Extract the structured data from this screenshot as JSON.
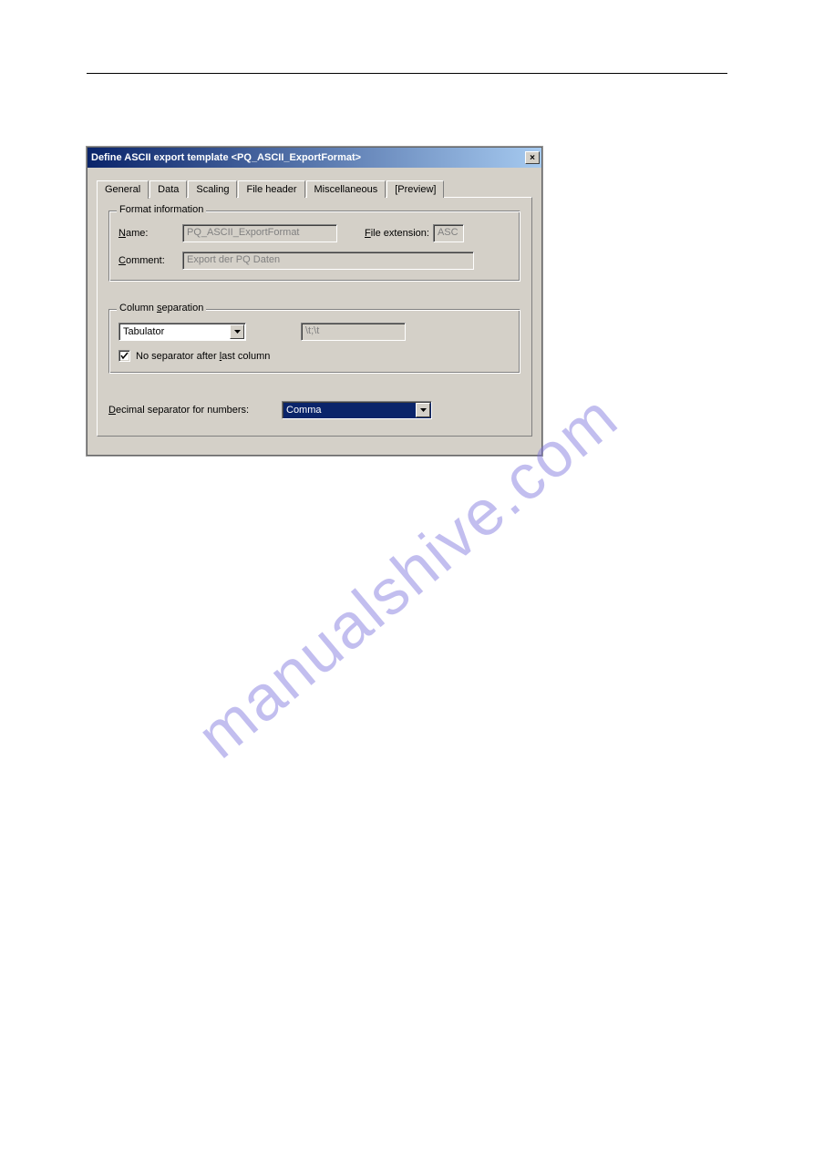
{
  "watermark": "manualshive.com",
  "dialog": {
    "title": "Define ASCII export template <PQ_ASCII_ExportFormat>",
    "close": "×",
    "tabs": [
      {
        "label": "General",
        "active": true
      },
      {
        "label": "Data",
        "active": false
      },
      {
        "label": "Scaling",
        "active": false
      },
      {
        "label": "File header",
        "active": false
      },
      {
        "label": "Miscellaneous",
        "active": false
      },
      {
        "label": "[Preview]",
        "active": false
      }
    ],
    "format_info": {
      "legend": "Format information",
      "name_label_pre": "N",
      "name_label_post": "ame:",
      "name_value": "PQ_ASCII_ExportFormat",
      "ext_label_pre": "F",
      "ext_label_post": "ile extension:",
      "ext_value": "ASC",
      "comment_label_pre": "C",
      "comment_label_post": "omment:",
      "comment_value": "Export der PQ Daten"
    },
    "col_sep": {
      "legend_pre": "Column ",
      "legend_u": "s",
      "legend_post": "eparation",
      "combo_value": "Tabulator",
      "sep_text": "\\t;\\t",
      "checkbox_checked": true,
      "checkbox_label_pre": "No separator after ",
      "checkbox_label_u": "l",
      "checkbox_label_post": "ast column"
    },
    "decimal": {
      "label_pre": "D",
      "label_post": "ecimal separator for numbers:",
      "combo_value": "Comma"
    }
  }
}
